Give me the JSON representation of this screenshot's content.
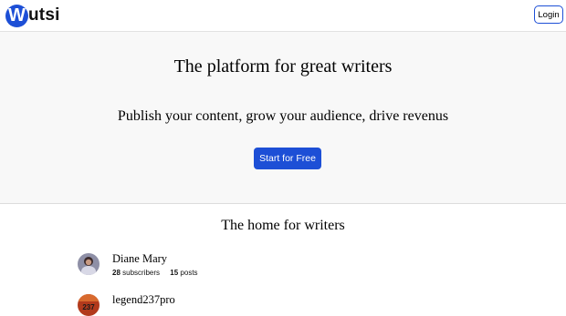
{
  "header": {
    "logo_letter": "W",
    "logo_rest": "utsi",
    "login_label": "Login"
  },
  "hero": {
    "title": "The platform for great writers",
    "subtitle": "Publish your content, grow your audience, drive revenus",
    "cta_label": "Start for Free"
  },
  "writers_section": {
    "title": "The home for writers",
    "writers": [
      {
        "name": "Diane Mary",
        "subscribers_count": "28",
        "subscribers_label": "subscribers",
        "posts_count": "15",
        "posts_label": "posts"
      },
      {
        "name": "legend237pro",
        "avatar_text": "237"
      }
    ]
  },
  "colors": {
    "brand_blue": "#1d4fd6",
    "hero_bg": "#f8f8f8"
  }
}
